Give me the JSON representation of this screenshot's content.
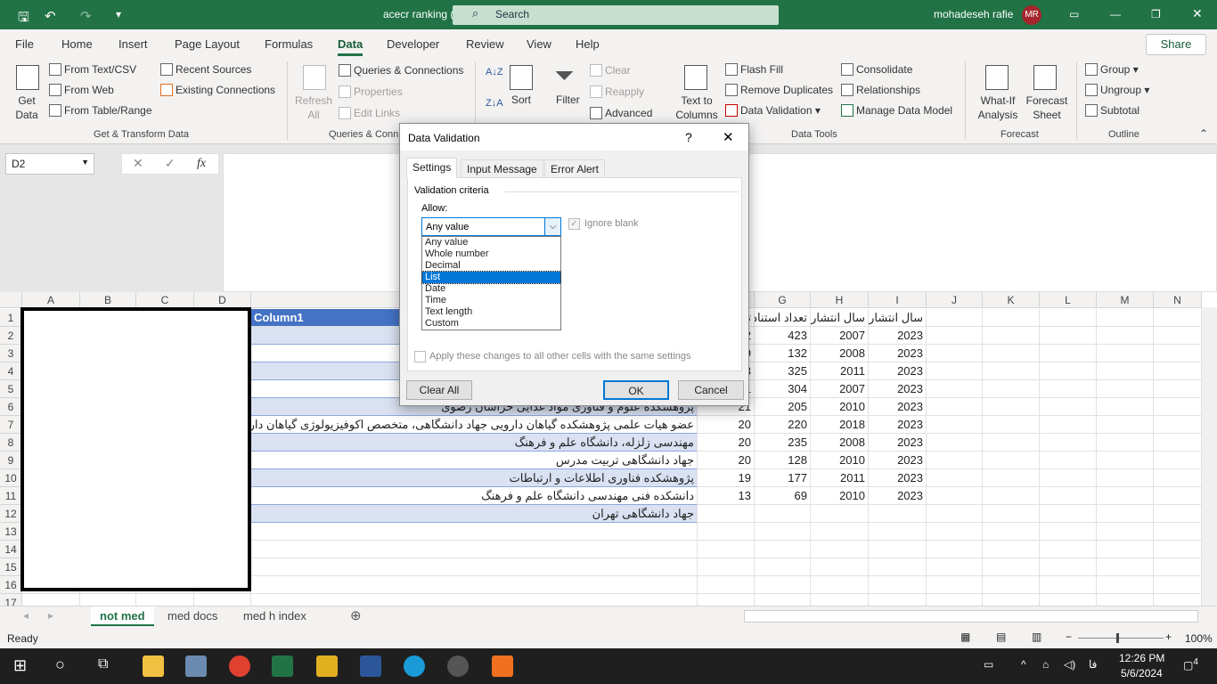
{
  "titlebar": {
    "doc_title": "acecr ranking (1)  -  Excel",
    "search": "Search",
    "user": "mohadeseh rafie",
    "initials": "MR"
  },
  "tabs": [
    "File",
    "Home",
    "Insert",
    "Page Layout",
    "Formulas",
    "Data",
    "Developer",
    "Review",
    "View",
    "Help"
  ],
  "active_tab": "Data",
  "share": "Share",
  "ribbon": {
    "get_data": "Get Data",
    "from_text": "From Text/CSV",
    "from_web": "From Web",
    "from_table": "From Table/Range",
    "recent_sources": "Recent Sources",
    "existing_connections": "Existing Connections",
    "group_get": "Get & Transform Data",
    "refresh_all": "Refresh All",
    "queries_connections": "Queries & Connections",
    "properties": "Properties",
    "edit_links": "Edit Links",
    "group_queries": "Queries & Conn",
    "sort": "Sort",
    "filter": "Filter",
    "clear": "Clear",
    "reapply": "Reapply",
    "advanced": "Advanced",
    "text_to_columns": "Text to Columns",
    "flash_fill": "Flash Fill",
    "remove_duplicates": "Remove Duplicates",
    "data_validation": "Data Validation",
    "consolidate": "Consolidate",
    "relationships": "Relationships",
    "manage_data_model": "Manage Data Model",
    "group_tools": "Data Tools",
    "what_if": "What-If Analysis",
    "forecast_sheet": "Forecast Sheet",
    "group_forecast": "Forecast",
    "group": "Group",
    "ungroup": "Ungroup",
    "subtotal": "Subtotal",
    "group_outline": "Outline"
  },
  "formula_bar": {
    "name_box": "D2",
    "fx": "fx",
    "value": ""
  },
  "columns": [
    "A",
    "B",
    "C",
    "D",
    "E",
    "F",
    "G",
    "H",
    "I",
    "J",
    "K",
    "L",
    "M",
    "N"
  ],
  "rows": [
    "1",
    "2",
    "3",
    "4",
    "5",
    "6",
    "7",
    "8",
    "9",
    "10",
    "11",
    "12",
    "13",
    "14",
    "15",
    "16",
    "17"
  ],
  "sheet": {
    "header": {
      "E": "Column1",
      "F": "تعداد استناد",
      "G": "تعداد استناد",
      "H": "سال انتشار",
      "I": "سال انتشار آ"
    },
    "data": [
      {
        "E": "",
        "F": "2",
        "G": "423",
        "H": "2007",
        "I": "2023"
      },
      {
        "E": "",
        "F": "9",
        "G": "132",
        "H": "2008",
        "I": "2023"
      },
      {
        "E": "",
        "F": "3",
        "G": "325",
        "H": "2011",
        "I": "2023"
      },
      {
        "E": "",
        "F": "1",
        "G": "304",
        "H": "2007",
        "I": "2023"
      },
      {
        "E": "پژوهشکده علوم و فناوری مواد غذایی خراسان رضوی",
        "F": "21",
        "G": "205",
        "H": "2010",
        "I": "2023"
      },
      {
        "E": "عضو هیات علمی پژوهشکده گیاهان دارویی جهاد دانشگاهی، متخصص اکوفیزیولوژی گیاهان دارویی",
        "F": "20",
        "G": "220",
        "H": "2018",
        "I": "2023"
      },
      {
        "E": "مهندسی زلزله، دانشگاه علم و فرهنگ",
        "F": "20",
        "G": "235",
        "H": "2008",
        "I": "2023"
      },
      {
        "E": "جهاد دانشگاهی تربیت مدرس",
        "F": "20",
        "G": "128",
        "H": "2010",
        "I": "2023"
      },
      {
        "E": "پژوهشکده فناوری اطلاعات و ارتباطات",
        "F": "19",
        "G": "177",
        "H": "2011",
        "I": "2023"
      },
      {
        "E": "دانشکده فنی مهندسی دانشگاه علم و فرهنگ",
        "F": "13",
        "G": "69",
        "H": "2010",
        "I": "2023"
      },
      {
        "E": "جهاد دانشگاهی تهران",
        "F": "",
        "G": "",
        "H": "",
        "I": ""
      }
    ]
  },
  "sheet_tabs": [
    "not med",
    "med docs",
    "med h index"
  ],
  "active_sheet": "not med",
  "status": {
    "ready": "Ready",
    "zoom": "100%"
  },
  "taskbar": {
    "time": "12:26 PM",
    "date": "5/6/2024",
    "lang": "فا",
    "notifications": "4"
  },
  "dialog": {
    "title": "Data Validation",
    "help": "?",
    "tabs": [
      "Settings",
      "Input Message",
      "Error Alert"
    ],
    "active_tab": "Settings",
    "section": "Validation criteria",
    "allow_label": "Allow:",
    "allow_value": "Any value",
    "options": [
      "Any value",
      "Whole number",
      "Decimal",
      "List",
      "Date",
      "Time",
      "Text length",
      "Custom"
    ],
    "highlighted_option": "List",
    "ignore_blank": "Ignore blank",
    "ignore_blank_checked": true,
    "apply_all": "Apply these changes to all other cells with the same settings",
    "apply_all_checked": false,
    "clear_all": "Clear All",
    "ok": "OK",
    "cancel": "Cancel"
  }
}
